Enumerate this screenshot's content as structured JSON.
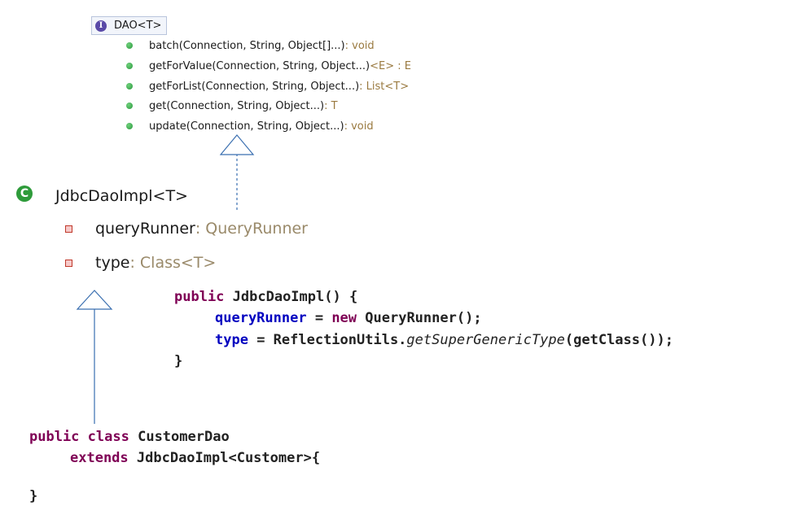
{
  "interface": {
    "icon_letter": "I",
    "name": "DAO<T>",
    "methods": [
      {
        "sig": "batch(Connection, String, Object[]...)",
        "ret": " : void"
      },
      {
        "sig": "getForValue(Connection, String, Object...)",
        "ret": " <E> : E"
      },
      {
        "sig": "getForList(Connection, String, Object...)",
        "ret": " : List<T>"
      },
      {
        "sig": "get(Connection, String, Object...)",
        "ret": " : T"
      },
      {
        "sig": "update(Connection, String, Object...)",
        "ret": " : void"
      }
    ]
  },
  "impl_class": {
    "icon_letter": "C",
    "name": "JdbcDaoImpl<T>",
    "fields": [
      {
        "name": "queryRunner",
        "type": " : QueryRunner"
      },
      {
        "name": "type",
        "type": " : Class<T>"
      }
    ]
  },
  "constructor_code": {
    "kw_public": "public",
    "sig": " JdbcDaoImpl() {",
    "line2_field": "queryRunner",
    "line2_mid": " = ",
    "line2_kw": "new",
    "line2_rest": " QueryRunner();",
    "line3_field": "type",
    "line3_mid": " = ReflectionUtils.",
    "line3_method": "getSuperGenericType",
    "line3_rest": "(getClass());",
    "close": "}"
  },
  "subclass_code": {
    "kw_public": "public",
    "kw_class": "class",
    "name": " CustomerDao",
    "kw_extends": "extends",
    "extends_rest": " JdbcDaoImpl<Customer>{",
    "close": "}"
  },
  "colors": {
    "keyword": "#7f0055",
    "field": "#0000c0",
    "return_type": "#9a7a40",
    "arrow": "#3a6fb0"
  }
}
